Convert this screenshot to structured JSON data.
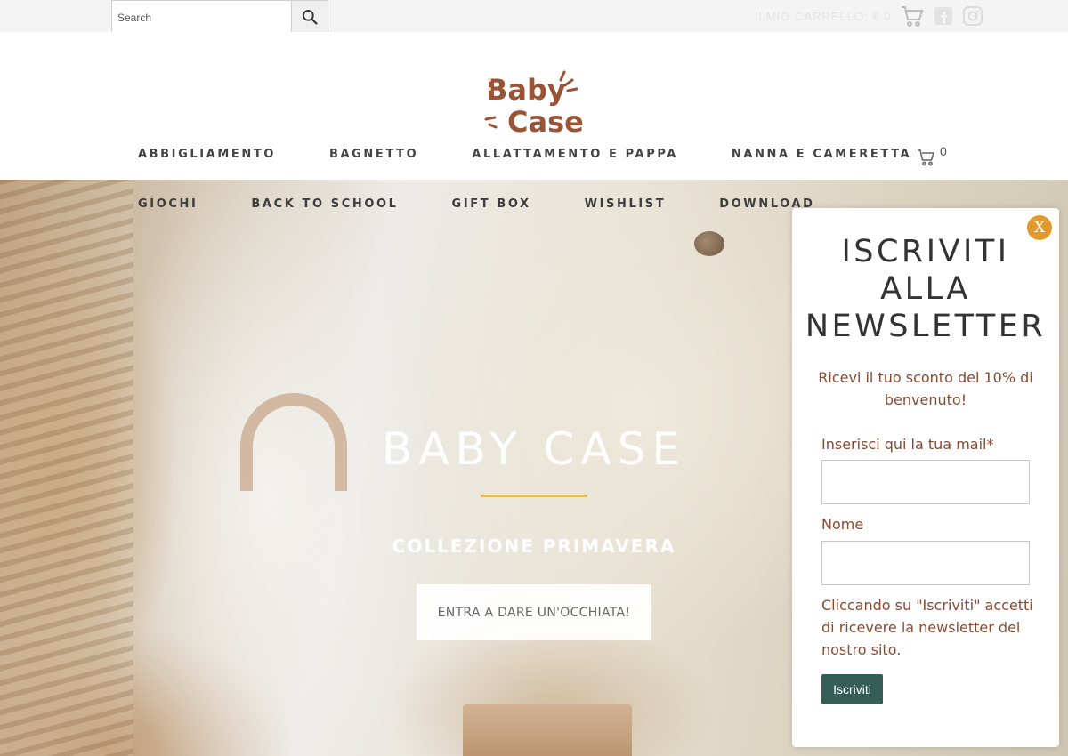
{
  "topbar": {
    "search": {
      "placeholder": "Search",
      "value": ""
    },
    "cart_text": "ILMIO CARRELLO: € 0",
    "icons": [
      "search-icon",
      "cart-icon",
      "facebook-icon",
      "instagram-icon"
    ]
  },
  "header": {
    "logo_text": [
      "Baby",
      "Case"
    ],
    "cart_count": "0",
    "menu_row1": [
      "ABBIGLIAMENTO",
      "BAGNETTO",
      "ALLATTAMENTO E PAPPA",
      "NANNA E CAMERETTA"
    ],
    "menu_row2": [
      "GIOCHI",
      "BACK TO SCHOOL",
      "GIFT BOX",
      "WISHLIST",
      "DOWNLOAD"
    ]
  },
  "hero": {
    "title": "BABY CASE",
    "subtitle": "COLLEZIONE PRIMAVERA",
    "cta": "ENTRA A DARE UN'OCCHIATA!"
  },
  "popup": {
    "close_label": "X",
    "title": "ISCRIVITI ALLA NEWSLETTER",
    "title_lines": [
      "ISCRIVITI",
      "ALLA",
      "NEWSLETTER"
    ],
    "description": "Ricevi il tuo sconto del 10% di benvenuto!",
    "email_label": "Inserisci qui la tua mail*",
    "email_value": "",
    "name_label": "Nome",
    "name_value": "",
    "note": "Cliccando su \"Iscriviti\" accetti di ricevere la newsletter del nostro sito.",
    "submit_label": "Iscriviti"
  },
  "colors": {
    "accent_brown": "#8a4a32",
    "close_orange": "#e49a2a",
    "submit_green": "#345e55",
    "divider_gold": "#e1bd61"
  }
}
